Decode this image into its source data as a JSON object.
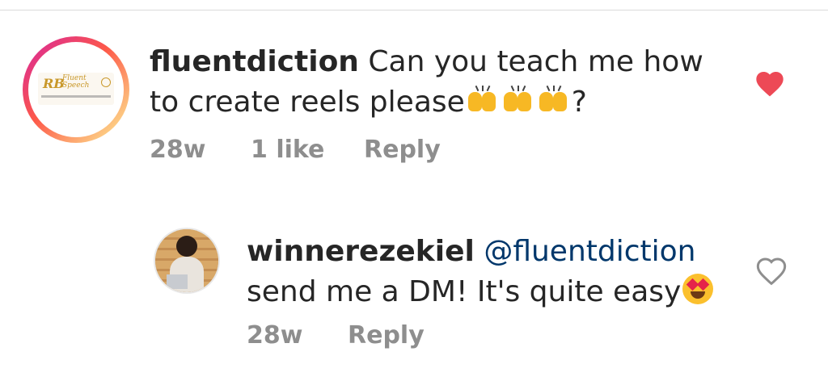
{
  "comments": [
    {
      "username": "fluentdiction",
      "text_before": "Can you teach me how to create reels please",
      "text_after": "?",
      "emoji": "raising-hands-emoji",
      "emoji_count": 3,
      "time": "28w",
      "likes": "1 like",
      "reply_label": "Reply",
      "liked": true,
      "avatar_logo": {
        "mark": "RB",
        "word1": "Fluent",
        "word2": "Speech"
      }
    },
    {
      "username": "winnerezekiel",
      "mention": "@fluentdiction",
      "text": "send me a DM! It's quite easy",
      "emoji": "heart-eyes-emoji",
      "time": "28w",
      "reply_label": "Reply",
      "liked": false
    }
  ],
  "colors": {
    "text": "#262626",
    "muted": "#8e8e8e",
    "mention": "#00376b",
    "heart_liked": "#ed4956",
    "heart_unliked": "#8e8e8e"
  }
}
